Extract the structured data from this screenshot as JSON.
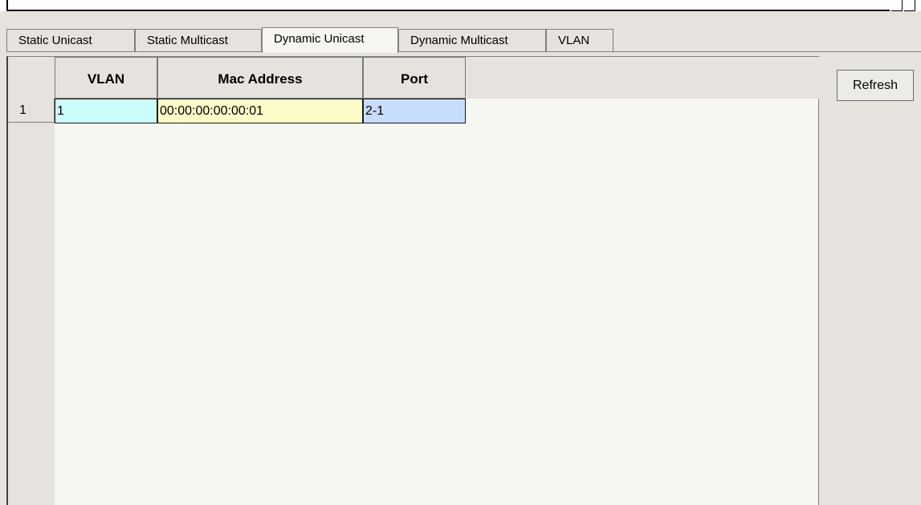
{
  "tabs": {
    "items": [
      {
        "label": "Static Unicast"
      },
      {
        "label": "Static Multicast"
      },
      {
        "label": "Dynamic Unicast"
      },
      {
        "label": "Dynamic Multicast"
      },
      {
        "label": "VLAN"
      }
    ],
    "active": "Dynamic Unicast"
  },
  "table": {
    "columns": [
      "VLAN",
      "Mac Address",
      "Port"
    ],
    "rows": [
      {
        "number": "1",
        "vlan": "1",
        "mac": "00:00:00:00:00:01",
        "port": "2-1"
      }
    ]
  },
  "actions": {
    "refresh_label": "Refresh"
  },
  "colors": {
    "vlan_cell": "#ccfdfd",
    "mac_cell": "#fdfcc8",
    "port_cell": "#c8dcfc",
    "panel_bg": "#e6e2de",
    "grid_bg": "#f7f7f2"
  }
}
